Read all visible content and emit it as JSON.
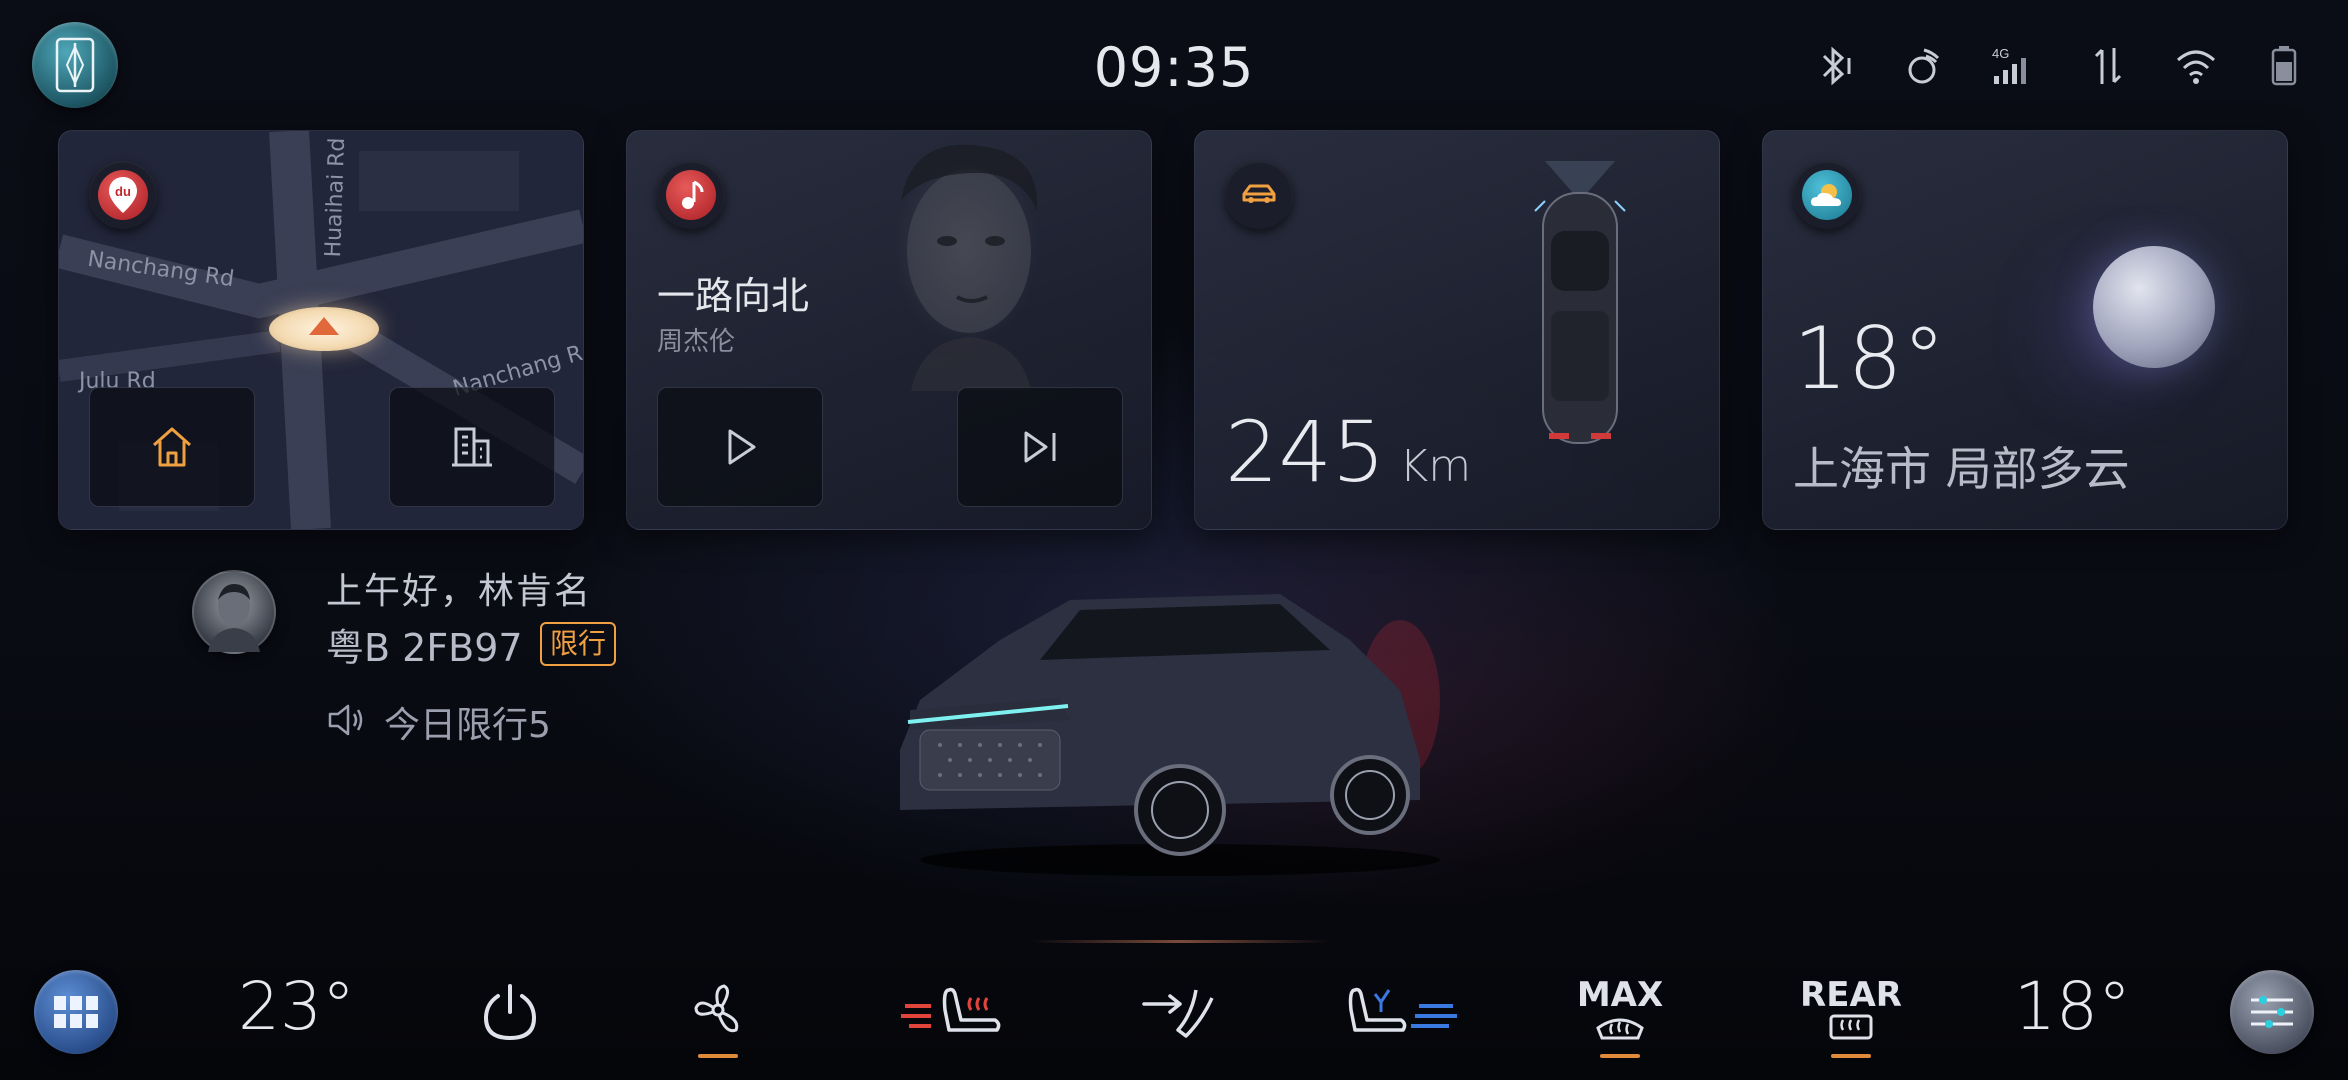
{
  "status_bar": {
    "time": "09:35",
    "icons": [
      "bluetooth-icon",
      "wireless-charging-icon",
      "4g-signal-icon",
      "data-transfer-icon",
      "wifi-icon",
      "battery-icon"
    ],
    "signal_label": "4G"
  },
  "navigation_card": {
    "icon": "baidu-map-icon",
    "icon_label": "du",
    "roads": [
      "Nanchang Rd",
      "Huaihai Rd",
      "Julu Rd",
      "Nanchang R"
    ],
    "buttons": [
      {
        "name": "home-button",
        "icon": "home-icon"
      },
      {
        "name": "company-button",
        "icon": "building-icon"
      }
    ]
  },
  "music_card": {
    "icon": "music-note-icon",
    "song_title": "一路向北",
    "artist": "周杰伦",
    "buttons": [
      {
        "name": "play-button",
        "icon": "play-icon"
      },
      {
        "name": "next-track-button",
        "icon": "next-track-icon"
      }
    ]
  },
  "vehicle_card": {
    "icon": "car-icon",
    "range_value": "245",
    "range_unit": "Km"
  },
  "weather_card": {
    "icon": "partly-cloudy-icon",
    "temperature": "18°",
    "location_condition": "上海市 局部多云"
  },
  "driver": {
    "greeting": "上午好，林肯名",
    "plate": "粤B 2FB97",
    "restriction_badge": "限行",
    "restriction_notice": "今日限行5"
  },
  "dock": {
    "driver_temp": "23°",
    "passenger_temp": "18°",
    "max_label": "MAX",
    "rear_label": "REAR",
    "items": [
      "apps-grid-icon",
      "power-icon",
      "fan-icon",
      "seat-heat-icon",
      "airflow-icon",
      "seat-vent-icon",
      "max-defrost-icon",
      "rear-defrost-icon",
      "settings-sliders-icon"
    ]
  },
  "colors": {
    "accent_orange": "#e08a3a",
    "seat_heat_red": "#e0443a",
    "seat_vent_blue": "#3a7ae0",
    "background": "#0a0c14"
  }
}
